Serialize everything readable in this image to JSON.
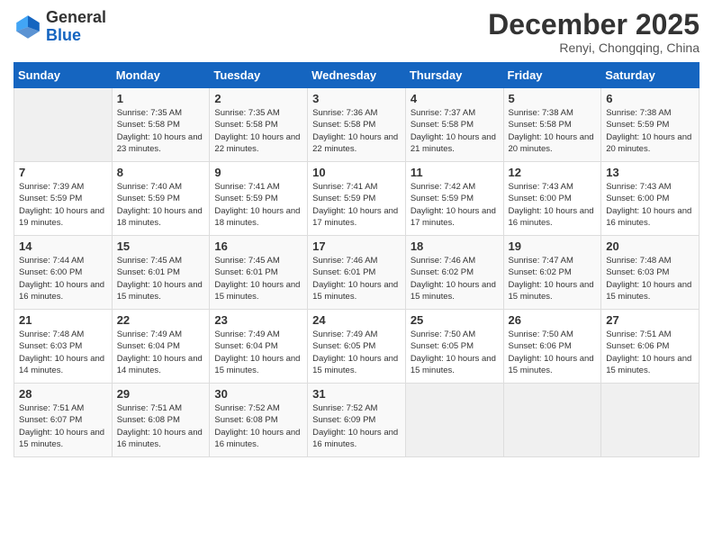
{
  "header": {
    "logo_line1": "General",
    "logo_line2": "Blue",
    "month": "December 2025",
    "location": "Renyi, Chongqing, China"
  },
  "days_of_week": [
    "Sunday",
    "Monday",
    "Tuesday",
    "Wednesday",
    "Thursday",
    "Friday",
    "Saturday"
  ],
  "weeks": [
    [
      {
        "num": "",
        "empty": true
      },
      {
        "num": "1",
        "sunrise": "Sunrise: 7:35 AM",
        "sunset": "Sunset: 5:58 PM",
        "daylight": "Daylight: 10 hours and 23 minutes."
      },
      {
        "num": "2",
        "sunrise": "Sunrise: 7:35 AM",
        "sunset": "Sunset: 5:58 PM",
        "daylight": "Daylight: 10 hours and 22 minutes."
      },
      {
        "num": "3",
        "sunrise": "Sunrise: 7:36 AM",
        "sunset": "Sunset: 5:58 PM",
        "daylight": "Daylight: 10 hours and 22 minutes."
      },
      {
        "num": "4",
        "sunrise": "Sunrise: 7:37 AM",
        "sunset": "Sunset: 5:58 PM",
        "daylight": "Daylight: 10 hours and 21 minutes."
      },
      {
        "num": "5",
        "sunrise": "Sunrise: 7:38 AM",
        "sunset": "Sunset: 5:58 PM",
        "daylight": "Daylight: 10 hours and 20 minutes."
      },
      {
        "num": "6",
        "sunrise": "Sunrise: 7:38 AM",
        "sunset": "Sunset: 5:59 PM",
        "daylight": "Daylight: 10 hours and 20 minutes."
      }
    ],
    [
      {
        "num": "7",
        "sunrise": "Sunrise: 7:39 AM",
        "sunset": "Sunset: 5:59 PM",
        "daylight": "Daylight: 10 hours and 19 minutes."
      },
      {
        "num": "8",
        "sunrise": "Sunrise: 7:40 AM",
        "sunset": "Sunset: 5:59 PM",
        "daylight": "Daylight: 10 hours and 18 minutes."
      },
      {
        "num": "9",
        "sunrise": "Sunrise: 7:41 AM",
        "sunset": "Sunset: 5:59 PM",
        "daylight": "Daylight: 10 hours and 18 minutes."
      },
      {
        "num": "10",
        "sunrise": "Sunrise: 7:41 AM",
        "sunset": "Sunset: 5:59 PM",
        "daylight": "Daylight: 10 hours and 17 minutes."
      },
      {
        "num": "11",
        "sunrise": "Sunrise: 7:42 AM",
        "sunset": "Sunset: 5:59 PM",
        "daylight": "Daylight: 10 hours and 17 minutes."
      },
      {
        "num": "12",
        "sunrise": "Sunrise: 7:43 AM",
        "sunset": "Sunset: 6:00 PM",
        "daylight": "Daylight: 10 hours and 16 minutes."
      },
      {
        "num": "13",
        "sunrise": "Sunrise: 7:43 AM",
        "sunset": "Sunset: 6:00 PM",
        "daylight": "Daylight: 10 hours and 16 minutes."
      }
    ],
    [
      {
        "num": "14",
        "sunrise": "Sunrise: 7:44 AM",
        "sunset": "Sunset: 6:00 PM",
        "daylight": "Daylight: 10 hours and 16 minutes."
      },
      {
        "num": "15",
        "sunrise": "Sunrise: 7:45 AM",
        "sunset": "Sunset: 6:01 PM",
        "daylight": "Daylight: 10 hours and 15 minutes."
      },
      {
        "num": "16",
        "sunrise": "Sunrise: 7:45 AM",
        "sunset": "Sunset: 6:01 PM",
        "daylight": "Daylight: 10 hours and 15 minutes."
      },
      {
        "num": "17",
        "sunrise": "Sunrise: 7:46 AM",
        "sunset": "Sunset: 6:01 PM",
        "daylight": "Daylight: 10 hours and 15 minutes."
      },
      {
        "num": "18",
        "sunrise": "Sunrise: 7:46 AM",
        "sunset": "Sunset: 6:02 PM",
        "daylight": "Daylight: 10 hours and 15 minutes."
      },
      {
        "num": "19",
        "sunrise": "Sunrise: 7:47 AM",
        "sunset": "Sunset: 6:02 PM",
        "daylight": "Daylight: 10 hours and 15 minutes."
      },
      {
        "num": "20",
        "sunrise": "Sunrise: 7:48 AM",
        "sunset": "Sunset: 6:03 PM",
        "daylight": "Daylight: 10 hours and 15 minutes."
      }
    ],
    [
      {
        "num": "21",
        "sunrise": "Sunrise: 7:48 AM",
        "sunset": "Sunset: 6:03 PM",
        "daylight": "Daylight: 10 hours and 14 minutes."
      },
      {
        "num": "22",
        "sunrise": "Sunrise: 7:49 AM",
        "sunset": "Sunset: 6:04 PM",
        "daylight": "Daylight: 10 hours and 14 minutes."
      },
      {
        "num": "23",
        "sunrise": "Sunrise: 7:49 AM",
        "sunset": "Sunset: 6:04 PM",
        "daylight": "Daylight: 10 hours and 15 minutes."
      },
      {
        "num": "24",
        "sunrise": "Sunrise: 7:49 AM",
        "sunset": "Sunset: 6:05 PM",
        "daylight": "Daylight: 10 hours and 15 minutes."
      },
      {
        "num": "25",
        "sunrise": "Sunrise: 7:50 AM",
        "sunset": "Sunset: 6:05 PM",
        "daylight": "Daylight: 10 hours and 15 minutes."
      },
      {
        "num": "26",
        "sunrise": "Sunrise: 7:50 AM",
        "sunset": "Sunset: 6:06 PM",
        "daylight": "Daylight: 10 hours and 15 minutes."
      },
      {
        "num": "27",
        "sunrise": "Sunrise: 7:51 AM",
        "sunset": "Sunset: 6:06 PM",
        "daylight": "Daylight: 10 hours and 15 minutes."
      }
    ],
    [
      {
        "num": "28",
        "sunrise": "Sunrise: 7:51 AM",
        "sunset": "Sunset: 6:07 PM",
        "daylight": "Daylight: 10 hours and 15 minutes."
      },
      {
        "num": "29",
        "sunrise": "Sunrise: 7:51 AM",
        "sunset": "Sunset: 6:08 PM",
        "daylight": "Daylight: 10 hours and 16 minutes."
      },
      {
        "num": "30",
        "sunrise": "Sunrise: 7:52 AM",
        "sunset": "Sunset: 6:08 PM",
        "daylight": "Daylight: 10 hours and 16 minutes."
      },
      {
        "num": "31",
        "sunrise": "Sunrise: 7:52 AM",
        "sunset": "Sunset: 6:09 PM",
        "daylight": "Daylight: 10 hours and 16 minutes."
      },
      {
        "num": "",
        "empty": true
      },
      {
        "num": "",
        "empty": true
      },
      {
        "num": "",
        "empty": true
      }
    ]
  ]
}
